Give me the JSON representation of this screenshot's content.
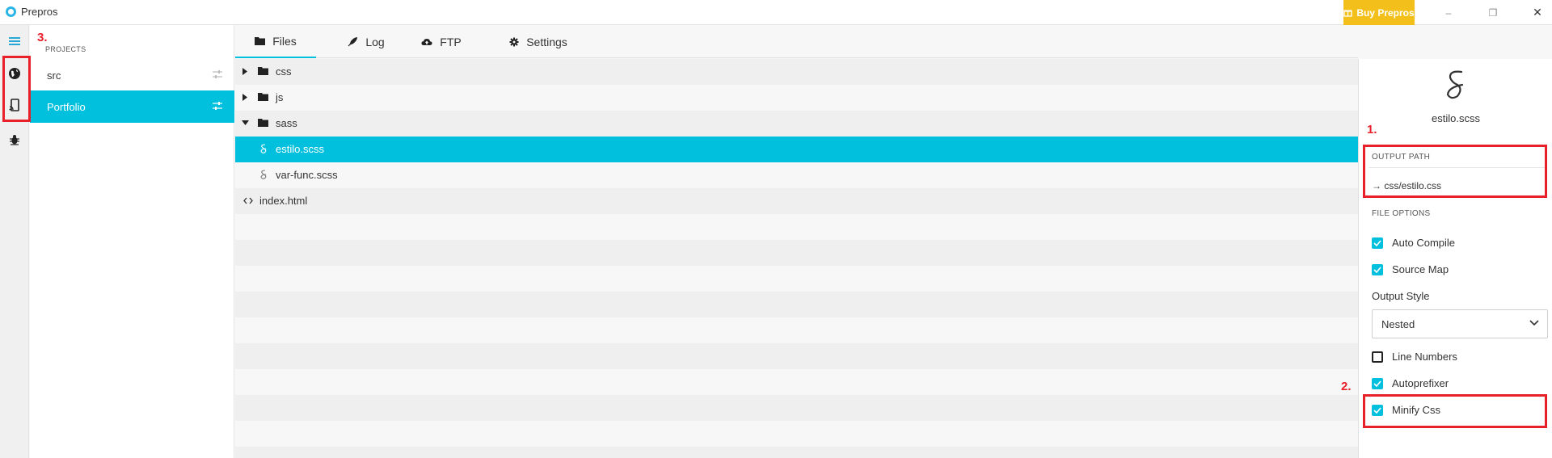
{
  "app": {
    "title": "Prepros",
    "buy_label": "Buy Prepros",
    "window_controls": {
      "minimize": "–",
      "maximize": "❐",
      "close": "✕"
    }
  },
  "rail": {
    "items": [
      {
        "name": "menu-icon"
      },
      {
        "name": "globe-icon"
      },
      {
        "name": "device-preview-icon"
      },
      {
        "name": "bug-icon"
      }
    ]
  },
  "projects": {
    "heading": "PROJECTS",
    "items": [
      {
        "label": "src",
        "selected": false
      },
      {
        "label": "Portfolio",
        "selected": true
      }
    ]
  },
  "tabs": [
    {
      "label": "Files",
      "icon": "folder-icon",
      "active": true
    },
    {
      "label": "Log",
      "icon": "pen-icon",
      "active": false
    },
    {
      "label": "FTP",
      "icon": "cloud-upload-icon",
      "active": false
    },
    {
      "label": "Settings",
      "icon": "gear-icon",
      "active": false
    }
  ],
  "files": {
    "rows": [
      {
        "label": "css",
        "type": "folder",
        "expanded": false
      },
      {
        "label": "js",
        "type": "folder",
        "expanded": false
      },
      {
        "label": "sass",
        "type": "folder",
        "expanded": true
      },
      {
        "label": "estilo.scss",
        "type": "sass-file",
        "selected": true
      },
      {
        "label": "var-func.scss",
        "type": "sass-file",
        "selected": false
      },
      {
        "label": "index.html",
        "type": "html-file",
        "selected": false
      }
    ]
  },
  "details": {
    "file_name": "estilo.scss",
    "output_path_heading": "OUTPUT PATH",
    "output_path": "→ css/estilo.css",
    "file_options_heading": "FILE OPTIONS",
    "auto_compile_label": "Auto Compile",
    "auto_compile": true,
    "source_map_label": "Source Map",
    "source_map": true,
    "output_style_label": "Output Style",
    "output_style_value": "Nested",
    "line_numbers_label": "Line Numbers",
    "line_numbers": false,
    "autoprefixer_label": "Autoprefixer",
    "autoprefixer": true,
    "minify_label": "Minify Css",
    "minify": true
  },
  "annotations": {
    "one": "1.",
    "two": "2.",
    "three": "3."
  },
  "colors": {
    "accent": "#00c0de",
    "buy": "#f3c01b",
    "annotation": "#e8202a"
  }
}
